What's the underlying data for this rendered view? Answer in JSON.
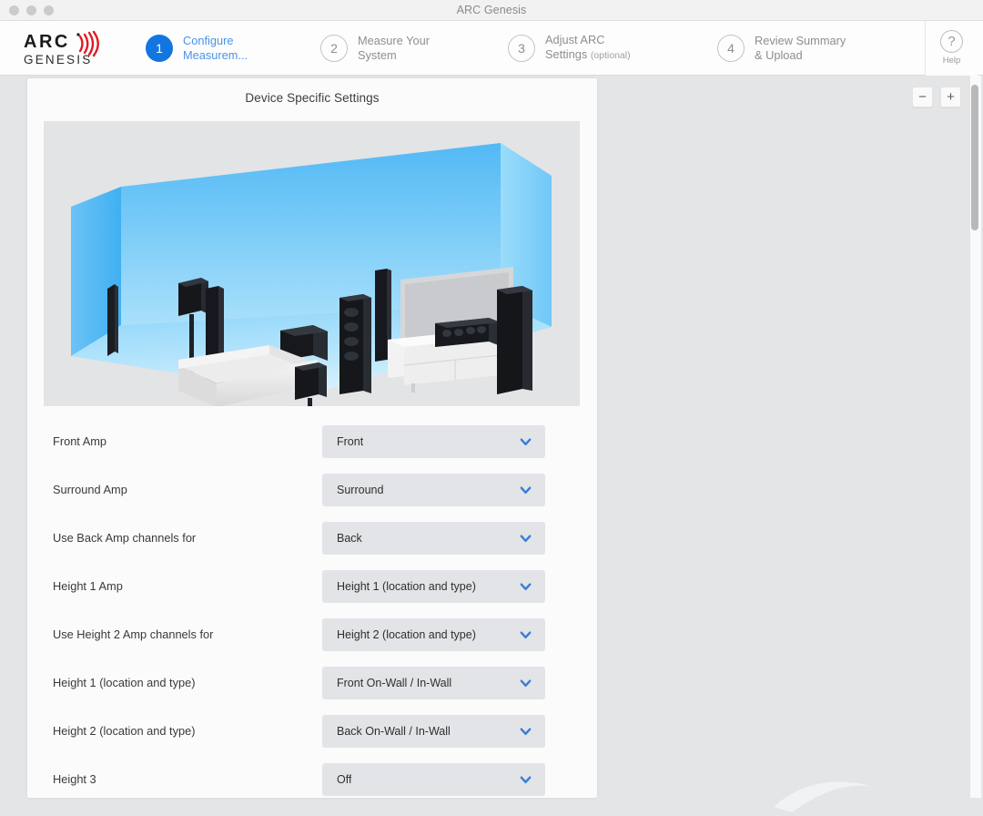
{
  "window": {
    "title": "ARC Genesis"
  },
  "logo": {
    "primary": "ARC",
    "secondary": "GENESIS",
    "wave_icon": "sound-wave-icon",
    "accent": "#e01b24"
  },
  "steps": [
    {
      "number": "1",
      "line1": "Configure",
      "line2": "Measurem...",
      "state": "active",
      "optional": ""
    },
    {
      "number": "2",
      "line1": "Measure Your",
      "line2": "System",
      "state": "idle",
      "optional": ""
    },
    {
      "number": "3",
      "line1": "Adjust ARC",
      "line2": "Settings",
      "state": "idle",
      "optional": "(optional)"
    },
    {
      "number": "4",
      "line1": "Review Summary",
      "line2": "& Upload",
      "state": "idle",
      "optional": ""
    }
  ],
  "help": {
    "glyph": "?",
    "label": "Help"
  },
  "zoom_controls": {
    "minus": "−",
    "plus": "+"
  },
  "card": {
    "title": "Device Specific Settings",
    "room_image_alt": "home-theater-room-diagram"
  },
  "form": {
    "rows": [
      {
        "label": "Front Amp",
        "value": "Front"
      },
      {
        "label": "Surround Amp",
        "value": "Surround"
      },
      {
        "label": "Use Back Amp channels for",
        "value": "Back"
      },
      {
        "label": "Height 1 Amp",
        "value": "Height 1 (location and type)"
      },
      {
        "label": "Use Height 2 Amp channels for",
        "value": "Height 2 (location and type)"
      },
      {
        "label": "Height 1 (location and type)",
        "value": "Front On-Wall / In-Wall"
      },
      {
        "label": "Height 2 (location and type)",
        "value": "Back On-Wall / In-Wall"
      },
      {
        "label": "Height 3",
        "value": "Off"
      }
    ]
  },
  "colors": {
    "accent_blue": "#1275e0",
    "step_text_active": "#4a93e8",
    "chevron_blue": "#3b7dd8",
    "app_background": "#e3e5e7",
    "card_background": "#fbfbfc",
    "select_background": "#e2e4e7"
  }
}
